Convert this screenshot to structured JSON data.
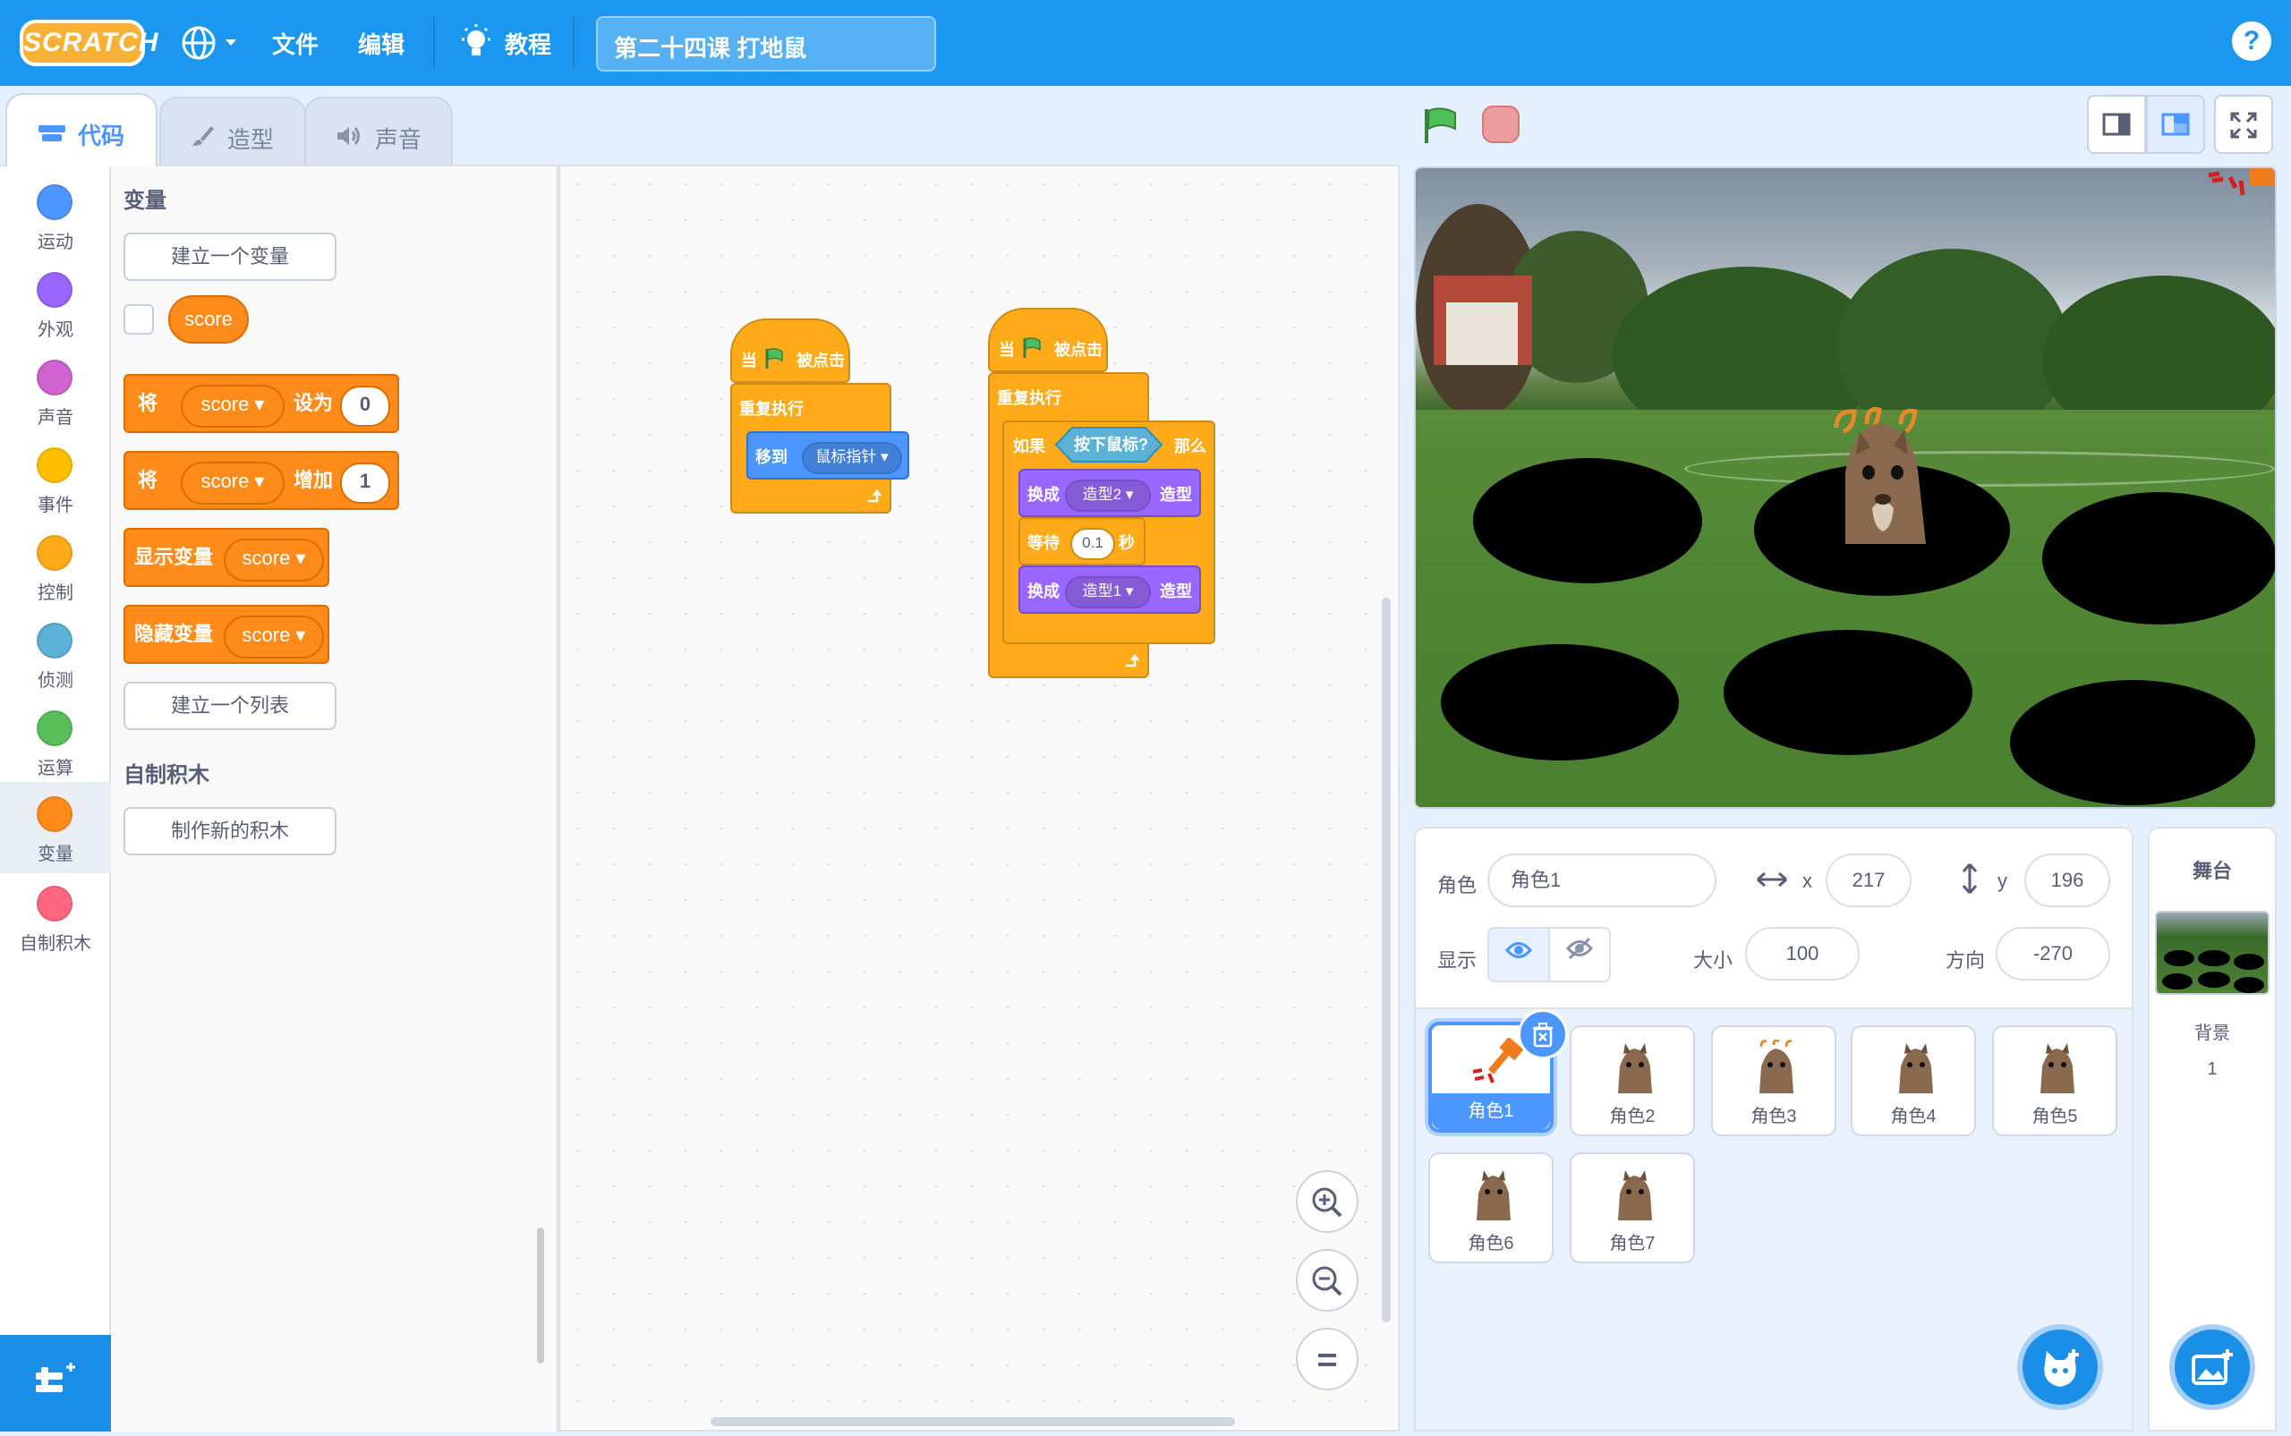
{
  "menubar": {
    "logo": "SCRATCH",
    "file": "文件",
    "edit": "编辑",
    "tutorials": "教程",
    "project_title": "第二十四课 打地鼠",
    "help": "?"
  },
  "tabs": [
    {
      "label": "代码"
    },
    {
      "label": "造型"
    },
    {
      "label": "声音"
    }
  ],
  "categories": [
    {
      "label": "运动",
      "color": "#4c97ff"
    },
    {
      "label": "外观",
      "color": "#9966ff"
    },
    {
      "label": "声音",
      "color": "#cf63cf"
    },
    {
      "label": "事件",
      "color": "#ffbf00"
    },
    {
      "label": "控制",
      "color": "#ffab19"
    },
    {
      "label": "侦测",
      "color": "#5cb1d6"
    },
    {
      "label": "运算",
      "color": "#59c059"
    },
    {
      "label": "变量",
      "color": "#ff8c1a"
    },
    {
      "label": "自制积木",
      "color": "#ff6680"
    }
  ],
  "palette": {
    "variables_heading": "变量",
    "make_variable": "建立一个变量",
    "score_reporter": "score",
    "set_block": {
      "word1": "将",
      "var": "score",
      "word2": "设为",
      "value": "0"
    },
    "change_block": {
      "word1": "将",
      "var": "score",
      "word2": "增加",
      "value": "1"
    },
    "show_block": {
      "word1": "显示变量",
      "var": "score"
    },
    "hide_block": {
      "word1": "隐藏变量",
      "var": "score"
    },
    "make_list": "建立一个列表",
    "my_blocks_heading": "自制积木",
    "make_block": "制作新的积木"
  },
  "scripts": {
    "s1": {
      "hat_when": "当",
      "hat_clicked": "被点击",
      "forever": "重复执行",
      "goto": "移到",
      "goto_target": "鼠标指针"
    },
    "s2": {
      "hat_when": "当",
      "hat_clicked": "被点击",
      "forever": "重复执行",
      "if": "如果",
      "condition": "按下鼠标?",
      "then": "那么",
      "switch1": "换成",
      "costume2": "造型2",
      "costume_word": "造型",
      "wait": "等待",
      "wait_value": "0.1",
      "seconds": "秒",
      "switch2": "换成",
      "costume1": "造型1",
      "costume_word2": "造型"
    }
  },
  "zoom": {
    "in": "+",
    "out": "−",
    "reset": "="
  },
  "sprite_info": {
    "sprite_label": "角色",
    "sprite_name": "角色1",
    "x_label": "x",
    "x_value": "217",
    "y_label": "y",
    "y_value": "196",
    "show_label": "显示",
    "size_label": "大小",
    "size_value": "100",
    "direction_label": "方向",
    "direction_value": "-270"
  },
  "sprites": [
    {
      "name": "角色1"
    },
    {
      "name": "角色2"
    },
    {
      "name": "角色3"
    },
    {
      "name": "角色4"
    },
    {
      "name": "角色5"
    },
    {
      "name": "角色6"
    },
    {
      "name": "角色7"
    }
  ],
  "stage_panel": {
    "title": "舞台",
    "backdrops_label": "背景",
    "backdrops_count": "1"
  }
}
